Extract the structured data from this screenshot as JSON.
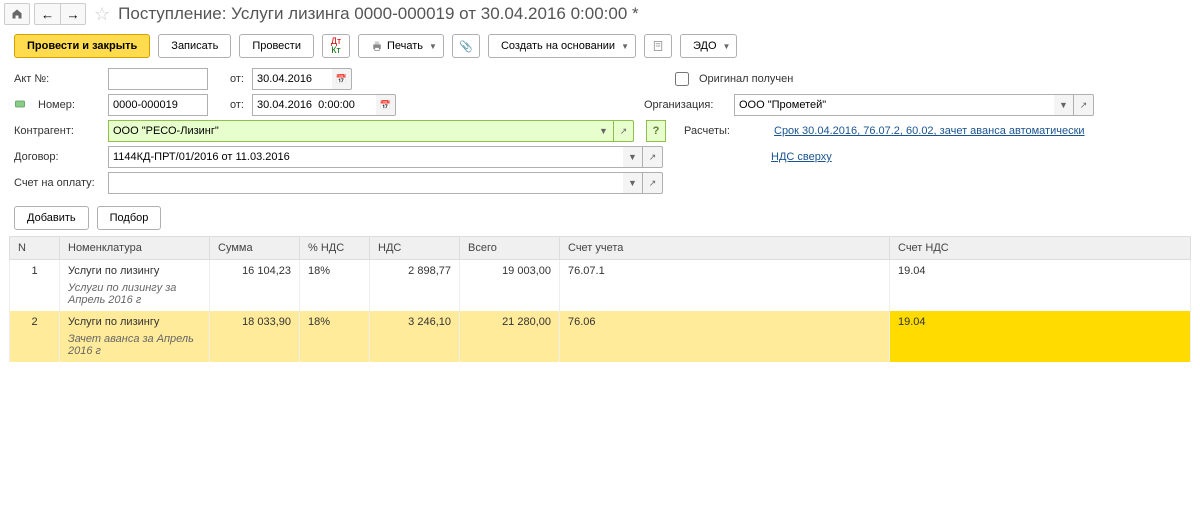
{
  "title": "Поступление: Услуги лизинга 0000-000019 от 30.04.2016 0:00:00 *",
  "toolbar": {
    "post_close": "Провести и закрыть",
    "save": "Записать",
    "post": "Провести",
    "print": "Печать",
    "create_based": "Создать на основании",
    "edo": "ЭДО"
  },
  "form": {
    "act_label": "Акт №:",
    "act_value": "",
    "from_label": "от:",
    "act_date": "30.04.2016",
    "number_label": "Номер:",
    "number_value": "0000-000019",
    "number_date": "30.04.2016  0:00:00",
    "original_label": "Оригинал получен",
    "org_label": "Организация:",
    "org_value": "ООО \"Прометей\"",
    "counterparty_label": "Контрагент:",
    "counterparty_value": "ООО \"РЕСО-Лизинг\"",
    "contract_label": "Договор:",
    "contract_value": "1144КД-ПРТ/01/2016 от 11.03.2016",
    "invoice_label": "Счет на оплату:",
    "invoice_value": "",
    "settlements_label": "Расчеты:",
    "settlements_link": "Срок 30.04.2016, 76.07.2, 60.02, зачет аванса автоматически",
    "nds_link": "НДС сверху"
  },
  "actions": {
    "add": "Добавить",
    "select": "Подбор"
  },
  "table": {
    "headers": {
      "n": "N",
      "nom": "Номенклатура",
      "sum": "Сумма",
      "pct_nds": "% НДС",
      "nds": "НДС",
      "total": "Всего",
      "account": "Счет учета",
      "nds_account": "Счет НДС"
    },
    "rows": [
      {
        "n": "1",
        "nom": "Услуги по лизингу",
        "desc": "Услуги по лизингу  за Апрель 2016 г",
        "sum": "16 104,23",
        "pct": "18%",
        "nds": "2 898,77",
        "total": "19 003,00",
        "account": "76.07.1",
        "nds_account": "19.04"
      },
      {
        "n": "2",
        "nom": "Услуги по лизингу",
        "desc": "Зачет аванса за Апрель 2016 г",
        "sum": "18 033,90",
        "pct": "18%",
        "nds": "3 246,10",
        "total": "21 280,00",
        "account": "76.06",
        "nds_account": "19.04"
      }
    ]
  }
}
